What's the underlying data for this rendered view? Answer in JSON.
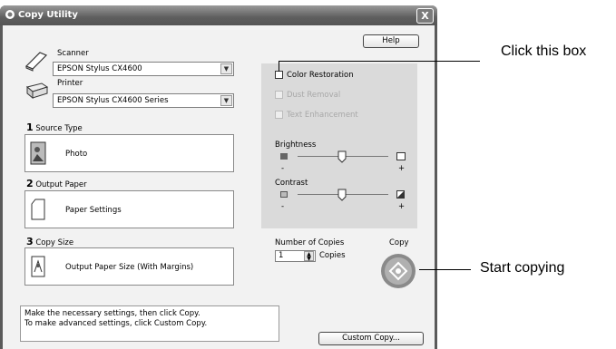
{
  "window": {
    "title": "Copy Utility",
    "close_label": "X"
  },
  "header": {
    "help_label": "Help"
  },
  "scanner": {
    "label": "Scanner",
    "selected": "EPSON Stylus CX4600"
  },
  "printer": {
    "label": "Printer",
    "selected": "EPSON Stylus CX4600 Series"
  },
  "source_type": {
    "number": "1",
    "label": "Source Type",
    "value": "Photo"
  },
  "output_paper": {
    "number": "2",
    "label": "Output Paper",
    "value": "Paper Settings"
  },
  "copy_size": {
    "number": "3",
    "label": "Copy Size",
    "value": "Output Paper Size (With Margins)"
  },
  "options": {
    "color_restoration": "Color Restoration",
    "dust_removal": "Dust Removal",
    "text_enhancement": "Text Enhancement"
  },
  "brightness": {
    "label": "Brightness",
    "minus": "-",
    "plus": "+",
    "level": 0.5
  },
  "contrast": {
    "label": "Contrast",
    "minus": "-",
    "plus": "+",
    "level": 0.5
  },
  "copies": {
    "label": "Number of Copies",
    "value": "1",
    "unit": "Copies"
  },
  "copy_button": {
    "label": "Copy"
  },
  "status": {
    "line1": "Make the necessary settings, then click Copy.",
    "line2": "To make advanced settings, click Custom Copy."
  },
  "custom_copy_label": "Custom Copy...",
  "callouts": {
    "click_box": "Click this box",
    "start_copying": "Start copying"
  }
}
